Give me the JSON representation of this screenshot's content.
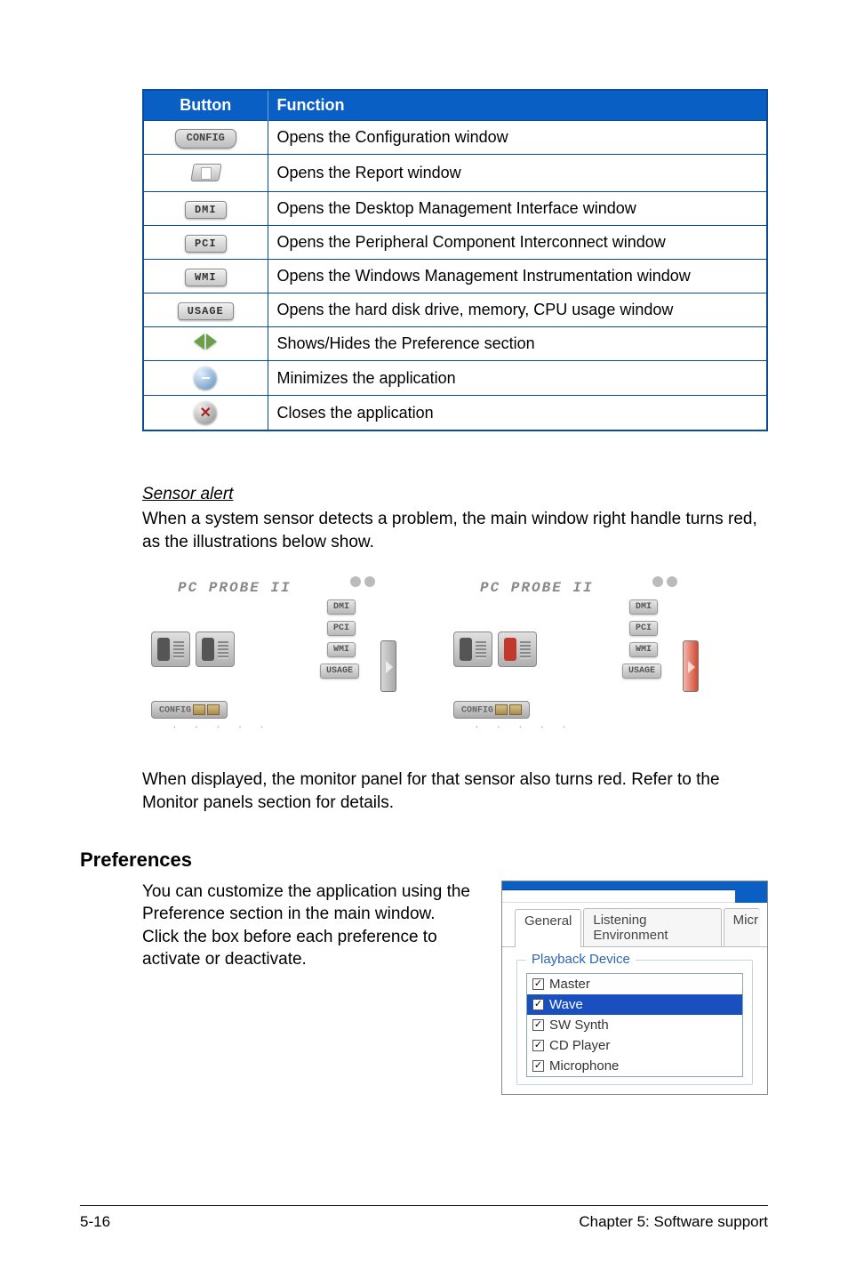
{
  "table": {
    "headers": {
      "button": "Button",
      "function": "Function"
    },
    "rows": [
      {
        "icon": "CONFIG",
        "func": "Opens the Configuration window"
      },
      {
        "icon": "report-folder",
        "func": "Opens the Report window"
      },
      {
        "icon": "DMI",
        "func": "Opens the Desktop Management Interface window"
      },
      {
        "icon": "PCI",
        "func": "Opens the Peripheral Component Interconnect window"
      },
      {
        "icon": "WMI",
        "func": "Opens the Windows Management Instrumentation window"
      },
      {
        "icon": "USAGE",
        "func": "Opens the hard disk drive, memory, CPU usage window"
      },
      {
        "icon": "arrows",
        "func": "Shows/Hides the Preference section"
      },
      {
        "icon": "minimize",
        "func": "Minimizes the application"
      },
      {
        "icon": "close",
        "func": "Closes the application"
      }
    ]
  },
  "sensor": {
    "title": "Sensor alert",
    "para1": "When a system sensor detects a problem, the main window right handle turns red, as the illustrations below show.",
    "para2": "When displayed, the monitor panel for that sensor also turns red. Refer to the Monitor panels section for details."
  },
  "probe": {
    "title": "PC PROBE II",
    "btns": {
      "dmi": "DMI",
      "pci": "PCI",
      "wmi": "WMI",
      "usage": "USAGE"
    },
    "config": "CONFIG"
  },
  "preferences": {
    "heading": "Preferences",
    "text": "You can customize the application using the Preference section in the main window. Click the box before each preference to activate or deactivate.",
    "tabs": {
      "general": "General",
      "listening": "Listening Environment",
      "mic": "Micr"
    },
    "group": "Playback Device",
    "items": {
      "master": "Master",
      "wave": "Wave",
      "swsynth": "SW Synth",
      "cdplayer": "CD Player",
      "microphone": "Microphone"
    }
  },
  "footer": {
    "left": "5-16",
    "right": "Chapter 5: Software support"
  }
}
